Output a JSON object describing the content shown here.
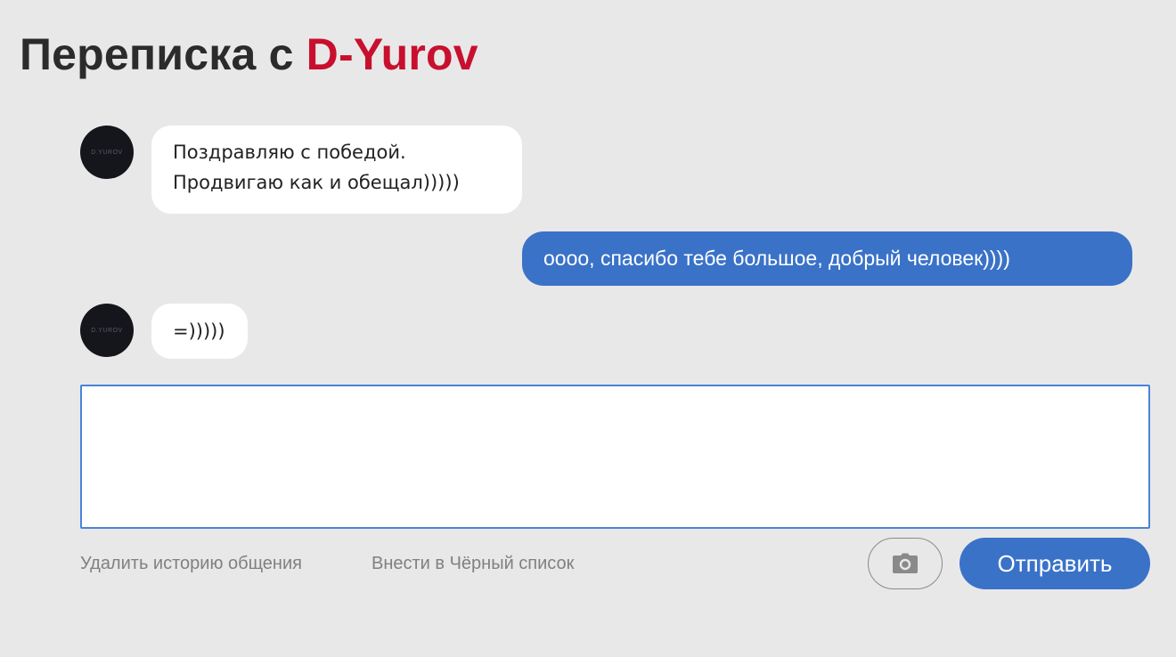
{
  "header": {
    "title_prefix": "Переписка с ",
    "contact_name": "D-Yurov"
  },
  "colors": {
    "background": "#e9e8e9",
    "accent_blue": "#3a72c8",
    "contact_name_red": "#c8102e",
    "link_gray": "#808080"
  },
  "messages": [
    {
      "direction": "incoming",
      "avatar_text": "D.YUROV",
      "lines": [
        "Поздравляю с победой.",
        "Продвигаю как и обещал)))))"
      ]
    },
    {
      "direction": "outgoing",
      "lines": [
        "оооо, спасибо тебе большое, добрый человек))))"
      ]
    },
    {
      "direction": "incoming",
      "avatar_text": "D.YUROV",
      "lines": [
        "=)))))"
      ]
    }
  ],
  "composer": {
    "value": "",
    "placeholder": ""
  },
  "actions": {
    "delete_history": "Удалить историю общения",
    "blacklist": "Внести в Чёрный список",
    "photo_icon": "camera-icon",
    "send_label": "Отправить"
  }
}
